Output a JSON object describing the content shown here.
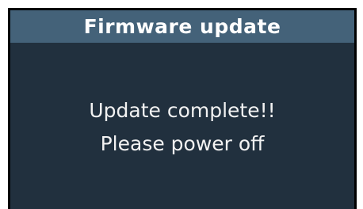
{
  "dialog": {
    "title": "Firmware update",
    "message_lines": [
      "Update complete!!",
      "Please power off"
    ]
  },
  "colors": {
    "title_bar": "#446279",
    "body_background": "#21303e",
    "frame": "#000000",
    "text": "#f2f2f2"
  }
}
